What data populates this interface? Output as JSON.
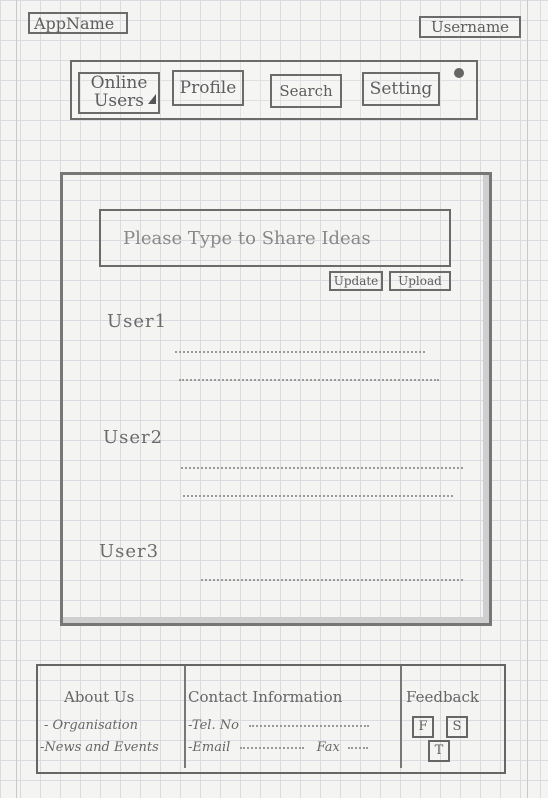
{
  "header": {
    "app_name": "AppName",
    "user_name": "Username"
  },
  "nav": {
    "items": [
      {
        "label": "Online Users"
      },
      {
        "label": "Profile"
      },
      {
        "label": "Search"
      },
      {
        "label": "Setting"
      }
    ]
  },
  "feed": {
    "share_placeholder": "Please Type to Share Ideas",
    "update_label": "Update",
    "upload_label": "Upload",
    "users": [
      {
        "name": "User1"
      },
      {
        "name": "User2"
      },
      {
        "name": "User3"
      }
    ]
  },
  "footer": {
    "about": {
      "title": "About Us",
      "items": [
        "- Organisation",
        "-News and Events"
      ]
    },
    "contact": {
      "title": "Contact Information",
      "tel": "-Tel. No",
      "email": "-Email",
      "fax": "Fax"
    },
    "feedback": {
      "title": "Feedback",
      "buttons": [
        "F",
        "S",
        "T"
      ]
    }
  }
}
